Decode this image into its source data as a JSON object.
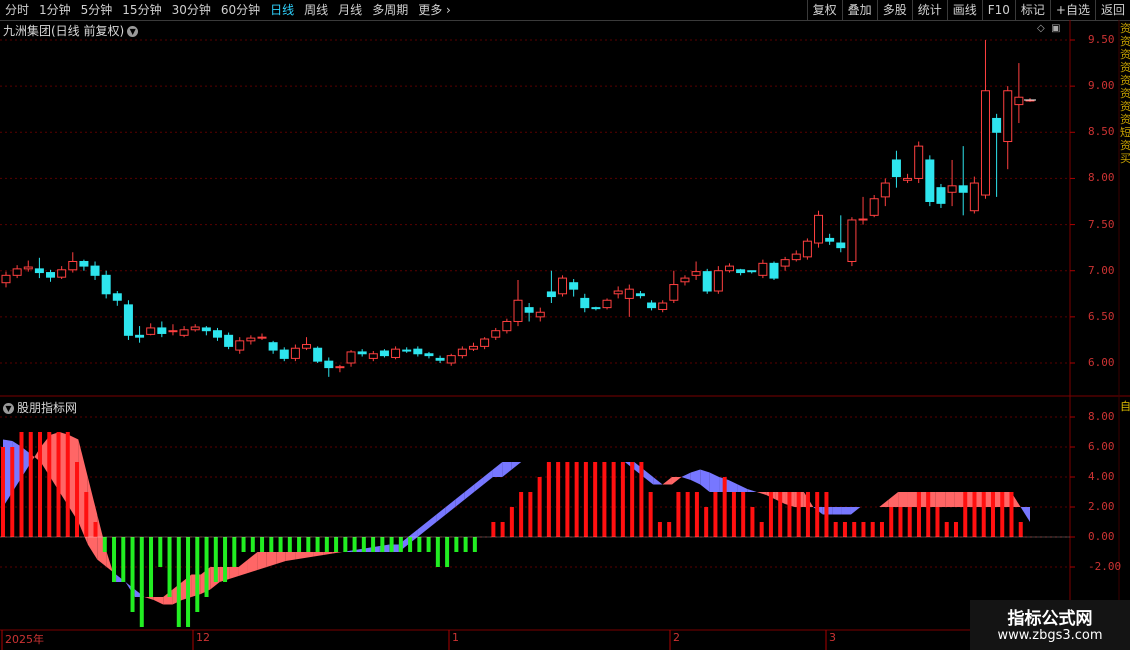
{
  "toolbar": {
    "left": [
      "分时",
      "1分钟",
      "5分钟",
      "15分钟",
      "30分钟",
      "60分钟",
      "日线",
      "周线",
      "月线",
      "多周期",
      "更多"
    ],
    "right": [
      "复权",
      "叠加",
      "多股",
      "统计",
      "画线",
      "F10",
      "标记",
      "+自选",
      "返回"
    ],
    "active": "日线"
  },
  "price_panel": {
    "title": "九洲集团(日线 前复权)",
    "yticks": [
      "9.50",
      "9.00",
      "8.50",
      "8.00",
      "7.50",
      "7.00",
      "6.50",
      "6.00"
    ]
  },
  "indicator_panel": {
    "title": "股朋指标网",
    "yticks": [
      "8.00",
      "6.00",
      "4.00",
      "2.00",
      "0.00",
      "-2.00"
    ]
  },
  "x_labels": [
    "2025年",
    "12",
    "1",
    "2",
    "3"
  ],
  "side_text": "资资资资资资资资短资买",
  "side2_text": "自",
  "watermark": {
    "line1": "指标公式网",
    "line2": "www.zbgs3.com"
  },
  "colors": {
    "up": "#ff4040",
    "down": "#2ee5ee",
    "grid": "#5a0000",
    "hist_up": "#ff1010",
    "hist_down": "#22ee22",
    "band_red": "#ff6666",
    "band_blue": "#7777ff"
  },
  "chart_data": [
    {
      "type": "candlestick",
      "candles": [
        [
          6.87,
          6.95,
          6.82,
          6.99
        ],
        [
          6.95,
          7.02,
          6.92,
          7.06
        ],
        [
          7.02,
          7.04,
          6.99,
          7.11
        ],
        [
          7.02,
          6.98,
          6.92,
          7.14
        ],
        [
          6.98,
          6.93,
          6.88,
          7.01
        ],
        [
          6.93,
          7.01,
          6.91,
          7.05
        ],
        [
          7.01,
          7.1,
          6.98,
          7.2
        ],
        [
          7.1,
          7.05,
          7.0,
          7.12
        ],
        [
          7.05,
          6.95,
          6.9,
          7.1
        ],
        [
          6.95,
          6.75,
          6.7,
          7.0
        ],
        [
          6.75,
          6.68,
          6.62,
          6.78
        ],
        [
          6.63,
          6.3,
          6.25,
          6.68
        ],
        [
          6.3,
          6.28,
          6.22,
          6.4
        ],
        [
          6.31,
          6.38,
          6.3,
          6.43
        ],
        [
          6.38,
          6.32,
          6.28,
          6.45
        ],
        [
          6.35,
          6.35,
          6.3,
          6.42
        ],
        [
          6.3,
          6.36,
          6.28,
          6.4
        ],
        [
          6.36,
          6.39,
          6.34,
          6.42
        ],
        [
          6.38,
          6.35,
          6.3,
          6.4
        ],
        [
          6.35,
          6.28,
          6.24,
          6.38
        ],
        [
          6.3,
          6.18,
          6.15,
          6.33
        ],
        [
          6.14,
          6.24,
          6.1,
          6.28
        ],
        [
          6.24,
          6.27,
          6.2,
          6.3
        ],
        [
          6.27,
          6.28,
          6.25,
          6.32
        ],
        [
          6.22,
          6.14,
          6.1,
          6.24
        ],
        [
          6.14,
          6.05,
          6.02,
          6.17
        ],
        [
          6.05,
          6.16,
          6.02,
          6.2
        ],
        [
          6.16,
          6.2,
          6.14,
          6.28
        ],
        [
          6.16,
          6.02,
          6.0,
          6.18
        ],
        [
          6.02,
          5.95,
          5.85,
          6.06
        ],
        [
          5.95,
          5.96,
          5.9,
          5.98
        ],
        [
          6.0,
          6.12,
          5.96,
          6.14
        ],
        [
          6.12,
          6.1,
          6.07,
          6.15
        ],
        [
          6.05,
          6.1,
          6.02,
          6.13
        ],
        [
          6.13,
          6.08,
          6.06,
          6.15
        ],
        [
          6.06,
          6.15,
          6.04,
          6.18
        ],
        [
          6.14,
          6.13,
          6.11,
          6.17
        ],
        [
          6.15,
          6.1,
          6.07,
          6.18
        ],
        [
          6.1,
          6.08,
          6.05,
          6.12
        ],
        [
          6.05,
          6.03,
          6.0,
          6.08
        ],
        [
          6.0,
          6.08,
          5.97,
          6.1
        ],
        [
          6.08,
          6.15,
          6.05,
          6.18
        ],
        [
          6.15,
          6.18,
          6.13,
          6.22
        ],
        [
          6.18,
          6.26,
          6.15,
          6.28
        ],
        [
          6.28,
          6.35,
          6.25,
          6.38
        ],
        [
          6.35,
          6.45,
          6.32,
          6.48
        ],
        [
          6.45,
          6.68,
          6.4,
          6.9
        ],
        [
          6.6,
          6.55,
          6.45,
          6.65
        ],
        [
          6.5,
          6.55,
          6.45,
          6.6
        ],
        [
          6.77,
          6.72,
          6.65,
          7.0
        ],
        [
          6.75,
          6.92,
          6.72,
          6.95
        ],
        [
          6.87,
          6.8,
          6.72,
          6.91
        ],
        [
          6.7,
          6.6,
          6.55,
          6.75
        ],
        [
          6.6,
          6.59,
          6.57,
          6.61
        ],
        [
          6.6,
          6.68,
          6.58,
          6.7
        ],
        [
          6.75,
          6.78,
          6.7,
          6.83
        ],
        [
          6.7,
          6.8,
          6.5,
          6.85
        ],
        [
          6.75,
          6.73,
          6.7,
          6.78
        ],
        [
          6.65,
          6.6,
          6.57,
          6.68
        ],
        [
          6.58,
          6.65,
          6.55,
          6.68
        ],
        [
          6.68,
          6.85,
          6.65,
          7.0
        ],
        [
          6.88,
          6.92,
          6.84,
          6.95
        ],
        [
          6.95,
          6.99,
          6.9,
          7.1
        ],
        [
          6.99,
          6.78,
          6.75,
          7.02
        ],
        [
          6.78,
          7.0,
          6.75,
          7.05
        ],
        [
          7.0,
          7.05,
          6.98,
          7.08
        ],
        [
          7.01,
          6.98,
          6.95,
          7.02
        ],
        [
          7.0,
          6.99,
          6.97,
          7.0
        ],
        [
          6.95,
          7.08,
          6.92,
          7.12
        ],
        [
          7.08,
          6.92,
          6.9,
          7.1
        ],
        [
          7.05,
          7.12,
          7.0,
          7.15
        ],
        [
          7.12,
          7.18,
          7.1,
          7.22
        ],
        [
          7.15,
          7.32,
          7.12,
          7.35
        ],
        [
          7.3,
          7.6,
          7.25,
          7.65
        ],
        [
          7.35,
          7.32,
          7.28,
          7.4
        ],
        [
          7.3,
          7.25,
          7.2,
          7.6
        ],
        [
          7.1,
          7.55,
          7.05,
          7.58
        ],
        [
          7.55,
          7.56,
          7.5,
          7.8
        ],
        [
          7.6,
          7.78,
          7.58,
          7.82
        ],
        [
          7.8,
          7.95,
          7.7,
          8.0
        ],
        [
          8.2,
          8.02,
          7.9,
          8.3
        ],
        [
          7.98,
          8.0,
          7.95,
          8.05
        ],
        [
          8.0,
          8.35,
          7.95,
          8.4
        ],
        [
          8.2,
          7.75,
          7.7,
          8.25
        ],
        [
          7.9,
          7.73,
          7.68,
          7.94
        ],
        [
          7.85,
          7.92,
          7.7,
          8.2
        ],
        [
          7.92,
          7.85,
          7.6,
          8.35
        ],
        [
          7.65,
          7.95,
          7.62,
          8.02
        ],
        [
          7.82,
          8.95,
          7.78,
          9.5
        ],
        [
          8.65,
          8.5,
          7.8,
          8.7
        ],
        [
          8.4,
          8.95,
          8.1,
          9.0
        ],
        [
          8.8,
          8.88,
          8.6,
          9.25
        ],
        [
          8.85,
          8.85,
          8.83,
          8.87
        ]
      ]
    },
    {
      "type": "bar",
      "hist": [
        6,
        6,
        7,
        7,
        7,
        7,
        7,
        7,
        5,
        3,
        1,
        -1,
        -3,
        -3,
        -5,
        -6,
        -4,
        -2,
        -4,
        -6,
        -6,
        -5,
        -4,
        -3,
        -3,
        -2,
        -1,
        -1,
        -1,
        -1,
        -1,
        -1,
        -1,
        -1,
        -1,
        -1,
        -1,
        -1,
        -1,
        -1,
        -1,
        -1,
        -1,
        -1,
        -1,
        -1,
        -1,
        -2,
        -2,
        -1,
        -1,
        -1,
        0,
        1,
        1,
        2,
        3,
        3,
        4,
        5,
        5,
        5,
        5,
        5,
        5,
        5,
        5,
        5,
        5,
        5,
        3,
        1,
        1,
        3,
        3,
        3,
        2,
        3,
        4,
        3,
        3,
        2,
        1,
        3,
        3,
        3,
        3,
        3,
        3,
        3,
        1,
        1,
        1,
        1,
        1,
        1,
        2,
        2,
        2,
        3,
        3,
        2,
        1,
        1,
        3,
        3,
        3,
        3,
        3,
        3,
        1,
        0
      ],
      "red_band": [
        2,
        3,
        4,
        5,
        6,
        6.8,
        7,
        6.8,
        6.5,
        4,
        1.5,
        -1,
        -3,
        -3,
        -4,
        -4,
        -4,
        -4,
        -3.5,
        -3,
        -2.5,
        -2.5,
        -2,
        -2,
        -2,
        -2,
        -1.5,
        -1,
        -1,
        -1,
        -1,
        -1,
        -1,
        -1,
        -1,
        -1,
        -1,
        -1,
        -1,
        -1,
        -1,
        -1,
        -1,
        -0.5,
        0,
        0.5,
        1,
        1.5,
        2,
        2.5,
        3,
        3.5,
        4,
        4,
        4.5,
        5,
        5,
        5,
        5,
        5,
        5,
        5,
        5,
        5,
        5,
        5,
        5,
        4.5,
        4,
        3.5,
        3.5,
        4,
        4,
        3.8,
        3.5,
        3,
        3,
        3,
        3,
        3,
        3,
        3,
        3,
        3,
        3,
        3,
        2,
        1.5,
        1.5,
        1.5,
        1.5,
        2,
        2,
        2,
        2.5,
        3,
        3,
        3,
        3,
        3,
        3,
        3,
        3,
        3,
        3,
        3,
        3,
        3,
        2,
        1
      ],
      "blue_band": [
        6.5,
        6.4,
        6.0,
        5.5,
        5.0,
        4.0,
        3.0,
        2.0,
        1.0,
        -0.5,
        -1.5,
        -2.0,
        -2.5,
        -3.0,
        -3.5,
        -4.0,
        -4.2,
        -4.5,
        -4.5,
        -4.2,
        -4.0,
        -3.8,
        -3.5,
        -3.0,
        -2.8,
        -2.6,
        -2.4,
        -2.2,
        -2.0,
        -1.8,
        -1.6,
        -1.5,
        -1.4,
        -1.3,
        -1.2,
        -1.1,
        -1.0,
        -0.9,
        -0.8,
        -0.7,
        -0.6,
        -0.5,
        -0.5,
        0,
        0.5,
        1,
        1.5,
        2,
        2.5,
        3,
        3.5,
        4,
        4.5,
        5,
        5,
        5,
        5,
        5,
        5,
        5,
        5,
        5,
        5,
        5,
        5,
        5,
        5,
        5,
        4.5,
        4,
        3.5,
        3.5,
        4,
        4.3,
        4.5,
        4.3,
        4,
        3.8,
        3.5,
        3.2,
        3,
        2.8,
        2.5,
        2.2,
        2,
        2,
        2,
        2,
        2,
        2,
        2,
        2,
        2,
        2,
        2,
        2,
        2,
        2,
        2,
        2,
        2,
        2,
        2,
        2,
        2,
        2,
        2,
        2,
        2,
        2,
        2,
        2,
        2,
        2,
        2
      ]
    }
  ]
}
